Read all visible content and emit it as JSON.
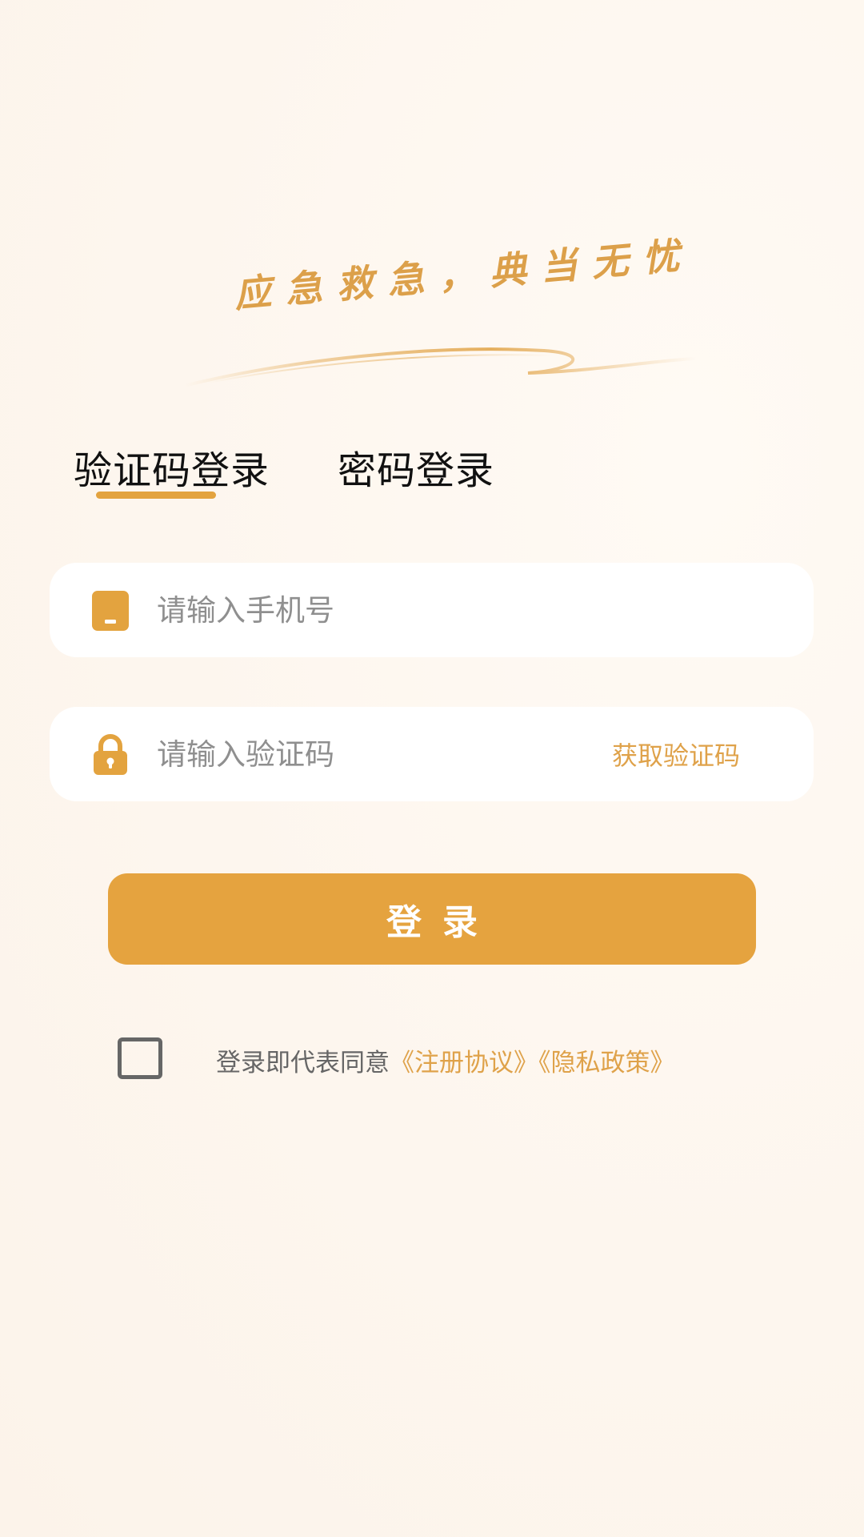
{
  "slogan": "应急救急，典当无忧",
  "tabs": {
    "sms_login": "验证码登录",
    "password_login": "密码登录",
    "active": "sms_login"
  },
  "phone_field": {
    "placeholder": "请输入手机号",
    "value": "",
    "icon": "phone-icon"
  },
  "code_field": {
    "placeholder": "请输入验证码",
    "value": "",
    "icon": "lock-icon",
    "get_code_label": "获取验证码"
  },
  "login_button": {
    "label": "登录"
  },
  "agreement": {
    "checked": false,
    "prefix": "登录即代表同意",
    "register_agreement": "《注册协议》",
    "privacy_policy": "《隐私政策》"
  },
  "colors": {
    "accent": "#e5a33f",
    "background": "#fdf6ee",
    "link": "#dfa24a"
  }
}
